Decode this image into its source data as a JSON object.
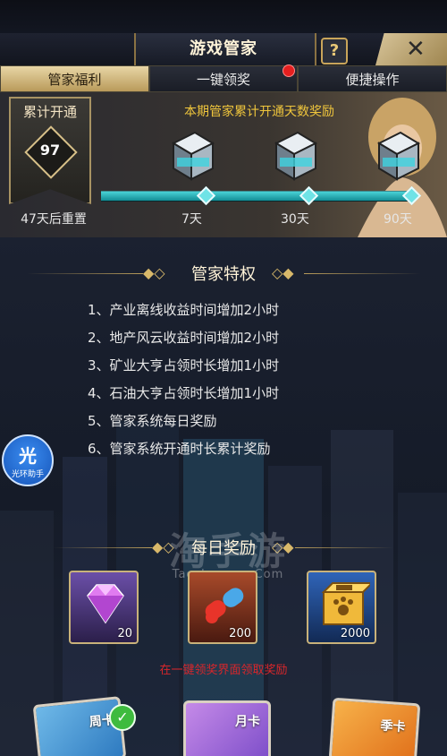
{
  "header": {
    "title": "游戏管家",
    "help_icon": "?",
    "close_icon": "✕"
  },
  "tabs": [
    {
      "label": "管家福利",
      "active": true
    },
    {
      "label": "一键领奖",
      "active": false,
      "has_dot": true
    },
    {
      "label": "便捷操作",
      "active": false
    }
  ],
  "accumulate": {
    "badge_label": "累计开通",
    "days": "97",
    "reset_text": "47天后重置",
    "title": "本期管家累计开通天数奖励",
    "progress": 1.0,
    "milestones": [
      {
        "label": "7天"
      },
      {
        "label": "30天"
      },
      {
        "label": "90天"
      }
    ],
    "colors": {
      "accent": "#f0c63c",
      "progress": "#2fb9c0"
    }
  },
  "privileges": {
    "title": "管家特权",
    "items": [
      "1、产业离线收益时间增加2小时",
      "2、地产风云收益时间增加2小时",
      "3、矿业大亨占领时长增加1小时",
      "4、石油大亨占领时长增加1小时",
      "5、管家系统每日奖励",
      "6、管家系统开通时长累计奖励"
    ]
  },
  "float_button": {
    "big": "光",
    "small": "光环助手"
  },
  "watermark": {
    "big": "淘手游",
    "small": "Taoshouyou.Com"
  },
  "daily": {
    "title": "每日奖励",
    "rewards": [
      {
        "icon": "diamond-icon",
        "count": "20"
      },
      {
        "icon": "capsule-pill-icon",
        "count": "200"
      },
      {
        "icon": "paw-box-icon",
        "count": "2000"
      }
    ],
    "note": "在一键领奖界面领取奖励"
  },
  "cards": [
    {
      "label": "周卡",
      "purchased": true
    },
    {
      "label": "月卡",
      "purchased": false
    },
    {
      "label": "季卡",
      "purchased": false
    }
  ]
}
